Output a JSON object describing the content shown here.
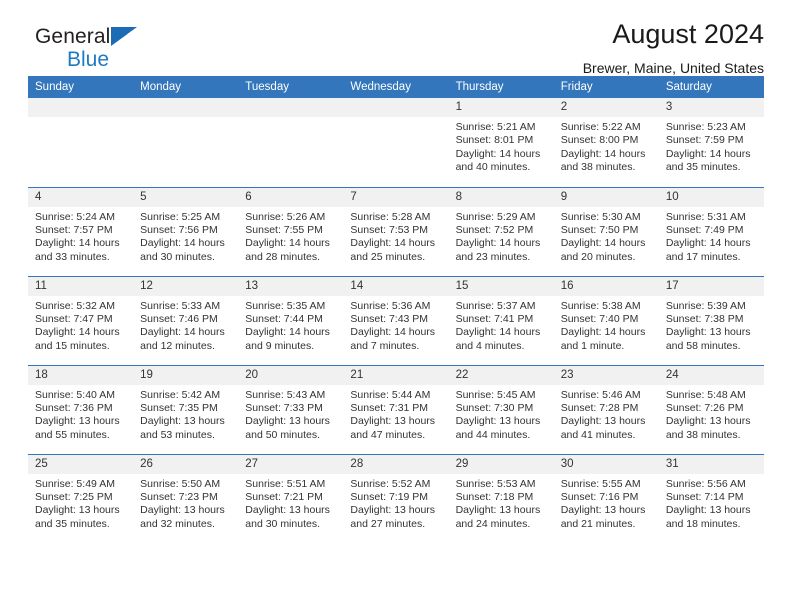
{
  "brand": {
    "name_part1": "General",
    "name_part2": "Blue",
    "flag_icon": "triangle-flag-icon"
  },
  "header": {
    "title": "August 2024",
    "subtitle": "Brewer, Maine, United States"
  },
  "colors": {
    "header_blue": "#3376bb",
    "daynum_gray": "#f1f1f1",
    "brand_blue": "#1f7ac4",
    "text": "#333333"
  },
  "weekday_headers": [
    "Sunday",
    "Monday",
    "Tuesday",
    "Wednesday",
    "Thursday",
    "Friday",
    "Saturday"
  ],
  "labels": {
    "sunrise_prefix": "Sunrise:",
    "sunset_prefix": "Sunset:",
    "daylight_prefix": "Daylight:"
  },
  "weeks": [
    [
      {
        "day": "",
        "empty": true
      },
      {
        "day": "",
        "empty": true
      },
      {
        "day": "",
        "empty": true
      },
      {
        "day": "",
        "empty": true
      },
      {
        "day": "1",
        "sunrise": "Sunrise: 5:21 AM",
        "sunset": "Sunset: 8:01 PM",
        "daylight_1": "Daylight: 14 hours",
        "daylight_2": "and 40 minutes."
      },
      {
        "day": "2",
        "sunrise": "Sunrise: 5:22 AM",
        "sunset": "Sunset: 8:00 PM",
        "daylight_1": "Daylight: 14 hours",
        "daylight_2": "and 38 minutes."
      },
      {
        "day": "3",
        "sunrise": "Sunrise: 5:23 AM",
        "sunset": "Sunset: 7:59 PM",
        "daylight_1": "Daylight: 14 hours",
        "daylight_2": "and 35 minutes."
      }
    ],
    [
      {
        "day": "4",
        "sunrise": "Sunrise: 5:24 AM",
        "sunset": "Sunset: 7:57 PM",
        "daylight_1": "Daylight: 14 hours",
        "daylight_2": "and 33 minutes."
      },
      {
        "day": "5",
        "sunrise": "Sunrise: 5:25 AM",
        "sunset": "Sunset: 7:56 PM",
        "daylight_1": "Daylight: 14 hours",
        "daylight_2": "and 30 minutes."
      },
      {
        "day": "6",
        "sunrise": "Sunrise: 5:26 AM",
        "sunset": "Sunset: 7:55 PM",
        "daylight_1": "Daylight: 14 hours",
        "daylight_2": "and 28 minutes."
      },
      {
        "day": "7",
        "sunrise": "Sunrise: 5:28 AM",
        "sunset": "Sunset: 7:53 PM",
        "daylight_1": "Daylight: 14 hours",
        "daylight_2": "and 25 minutes."
      },
      {
        "day": "8",
        "sunrise": "Sunrise: 5:29 AM",
        "sunset": "Sunset: 7:52 PM",
        "daylight_1": "Daylight: 14 hours",
        "daylight_2": "and 23 minutes."
      },
      {
        "day": "9",
        "sunrise": "Sunrise: 5:30 AM",
        "sunset": "Sunset: 7:50 PM",
        "daylight_1": "Daylight: 14 hours",
        "daylight_2": "and 20 minutes."
      },
      {
        "day": "10",
        "sunrise": "Sunrise: 5:31 AM",
        "sunset": "Sunset: 7:49 PM",
        "daylight_1": "Daylight: 14 hours",
        "daylight_2": "and 17 minutes."
      }
    ],
    [
      {
        "day": "11",
        "sunrise": "Sunrise: 5:32 AM",
        "sunset": "Sunset: 7:47 PM",
        "daylight_1": "Daylight: 14 hours",
        "daylight_2": "and 15 minutes."
      },
      {
        "day": "12",
        "sunrise": "Sunrise: 5:33 AM",
        "sunset": "Sunset: 7:46 PM",
        "daylight_1": "Daylight: 14 hours",
        "daylight_2": "and 12 minutes."
      },
      {
        "day": "13",
        "sunrise": "Sunrise: 5:35 AM",
        "sunset": "Sunset: 7:44 PM",
        "daylight_1": "Daylight: 14 hours",
        "daylight_2": "and 9 minutes."
      },
      {
        "day": "14",
        "sunrise": "Sunrise: 5:36 AM",
        "sunset": "Sunset: 7:43 PM",
        "daylight_1": "Daylight: 14 hours",
        "daylight_2": "and 7 minutes."
      },
      {
        "day": "15",
        "sunrise": "Sunrise: 5:37 AM",
        "sunset": "Sunset: 7:41 PM",
        "daylight_1": "Daylight: 14 hours",
        "daylight_2": "and 4 minutes."
      },
      {
        "day": "16",
        "sunrise": "Sunrise: 5:38 AM",
        "sunset": "Sunset: 7:40 PM",
        "daylight_1": "Daylight: 14 hours",
        "daylight_2": "and 1 minute."
      },
      {
        "day": "17",
        "sunrise": "Sunrise: 5:39 AM",
        "sunset": "Sunset: 7:38 PM",
        "daylight_1": "Daylight: 13 hours",
        "daylight_2": "and 58 minutes."
      }
    ],
    [
      {
        "day": "18",
        "sunrise": "Sunrise: 5:40 AM",
        "sunset": "Sunset: 7:36 PM",
        "daylight_1": "Daylight: 13 hours",
        "daylight_2": "and 55 minutes."
      },
      {
        "day": "19",
        "sunrise": "Sunrise: 5:42 AM",
        "sunset": "Sunset: 7:35 PM",
        "daylight_1": "Daylight: 13 hours",
        "daylight_2": "and 53 minutes."
      },
      {
        "day": "20",
        "sunrise": "Sunrise: 5:43 AM",
        "sunset": "Sunset: 7:33 PM",
        "daylight_1": "Daylight: 13 hours",
        "daylight_2": "and 50 minutes."
      },
      {
        "day": "21",
        "sunrise": "Sunrise: 5:44 AM",
        "sunset": "Sunset: 7:31 PM",
        "daylight_1": "Daylight: 13 hours",
        "daylight_2": "and 47 minutes."
      },
      {
        "day": "22",
        "sunrise": "Sunrise: 5:45 AM",
        "sunset": "Sunset: 7:30 PM",
        "daylight_1": "Daylight: 13 hours",
        "daylight_2": "and 44 minutes."
      },
      {
        "day": "23",
        "sunrise": "Sunrise: 5:46 AM",
        "sunset": "Sunset: 7:28 PM",
        "daylight_1": "Daylight: 13 hours",
        "daylight_2": "and 41 minutes."
      },
      {
        "day": "24",
        "sunrise": "Sunrise: 5:48 AM",
        "sunset": "Sunset: 7:26 PM",
        "daylight_1": "Daylight: 13 hours",
        "daylight_2": "and 38 minutes."
      }
    ],
    [
      {
        "day": "25",
        "sunrise": "Sunrise: 5:49 AM",
        "sunset": "Sunset: 7:25 PM",
        "daylight_1": "Daylight: 13 hours",
        "daylight_2": "and 35 minutes."
      },
      {
        "day": "26",
        "sunrise": "Sunrise: 5:50 AM",
        "sunset": "Sunset: 7:23 PM",
        "daylight_1": "Daylight: 13 hours",
        "daylight_2": "and 32 minutes."
      },
      {
        "day": "27",
        "sunrise": "Sunrise: 5:51 AM",
        "sunset": "Sunset: 7:21 PM",
        "daylight_1": "Daylight: 13 hours",
        "daylight_2": "and 30 minutes."
      },
      {
        "day": "28",
        "sunrise": "Sunrise: 5:52 AM",
        "sunset": "Sunset: 7:19 PM",
        "daylight_1": "Daylight: 13 hours",
        "daylight_2": "and 27 minutes."
      },
      {
        "day": "29",
        "sunrise": "Sunrise: 5:53 AM",
        "sunset": "Sunset: 7:18 PM",
        "daylight_1": "Daylight: 13 hours",
        "daylight_2": "and 24 minutes."
      },
      {
        "day": "30",
        "sunrise": "Sunrise: 5:55 AM",
        "sunset": "Sunset: 7:16 PM",
        "daylight_1": "Daylight: 13 hours",
        "daylight_2": "and 21 minutes."
      },
      {
        "day": "31",
        "sunrise": "Sunrise: 5:56 AM",
        "sunset": "Sunset: 7:14 PM",
        "daylight_1": "Daylight: 13 hours",
        "daylight_2": "and 18 minutes."
      }
    ]
  ]
}
